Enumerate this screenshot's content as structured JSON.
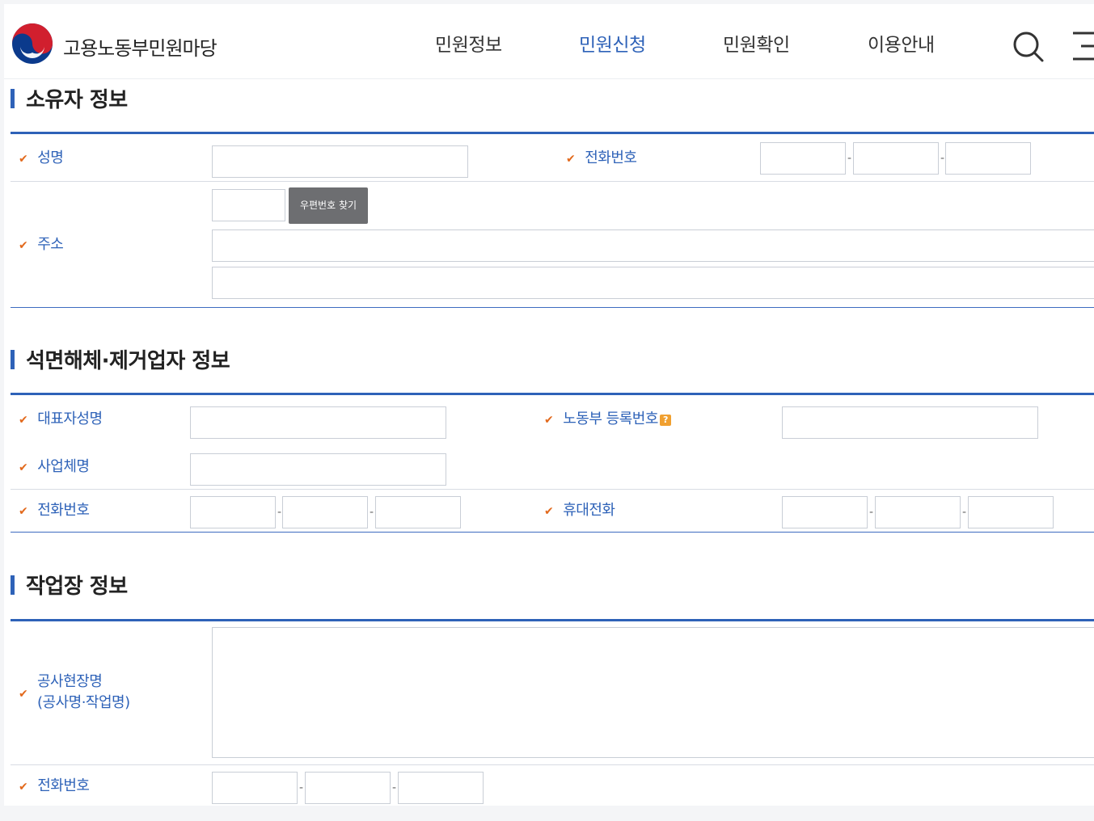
{
  "header": {
    "site_name": "고용노동부민원마당",
    "nav": [
      {
        "label": "민원정보",
        "active": false
      },
      {
        "label": "민원신청",
        "active": true
      },
      {
        "label": "민원확인",
        "active": false
      },
      {
        "label": "이용안내",
        "active": false
      }
    ]
  },
  "owner_section": {
    "title": "소유자 정보",
    "name_label": "성명",
    "phone_label": "전화번호",
    "address_label": "주소",
    "zip_button": "우편번호 찾기"
  },
  "contractor_section": {
    "title": "석면해체·제거업자 정보",
    "rep_name_label": "대표자성명",
    "reg_no_label": "노동부 등록번호",
    "help_mark": "?",
    "business_name_label": "사업체명",
    "phone_label": "전화번호",
    "mobile_label": "휴대전화"
  },
  "worksite_section": {
    "title": "작업장 정보",
    "site_name_label_line1": "공사현장명",
    "site_name_label_line2": "(공사명·작업명)",
    "phone_label": "전화번호"
  },
  "glyphs": {
    "check": "✔",
    "dash": "-"
  },
  "colors": {
    "accent": "#2e62b8",
    "check": "#e2691c",
    "button": "#6d6e71"
  }
}
